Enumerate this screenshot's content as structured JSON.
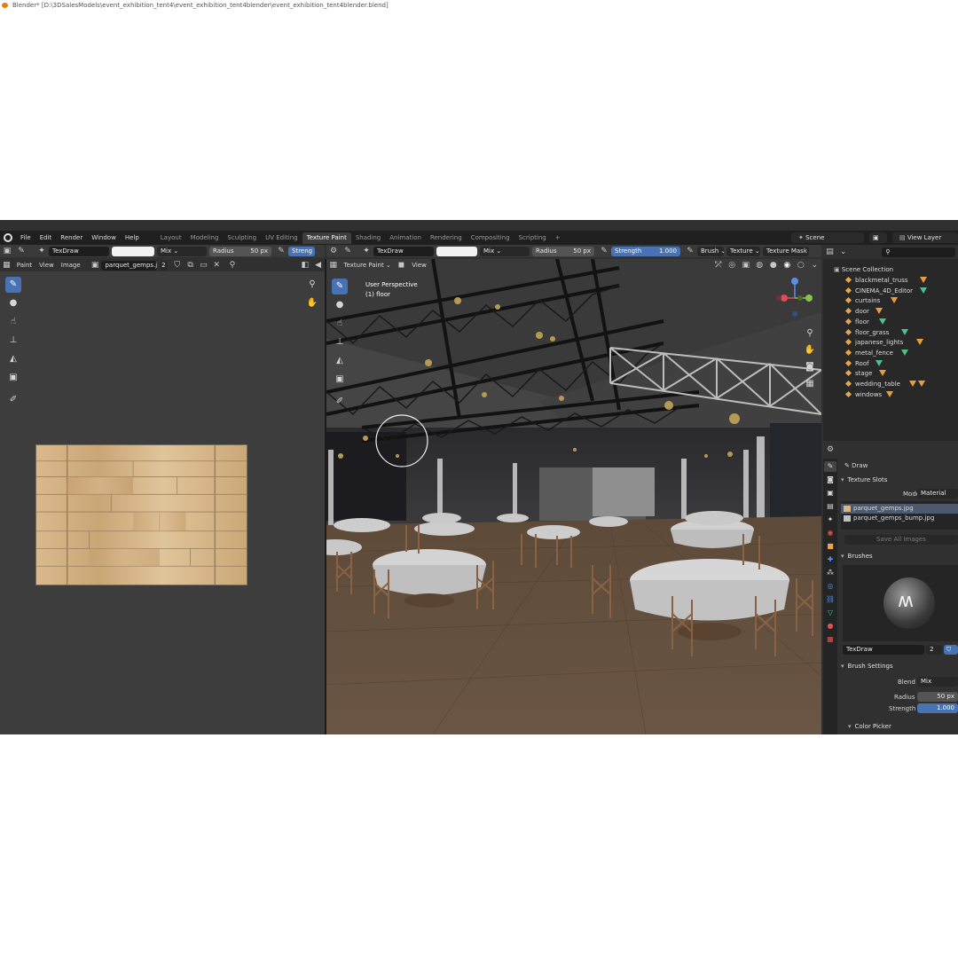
{
  "window": {
    "title": "Blender* [D:\\3DSalesModels\\event_exhibition_tent4\\event_exhibition_tent4blender\\event_exhibition_tent4blender.blend]"
  },
  "menu": [
    "File",
    "Edit",
    "Render",
    "Window",
    "Help"
  ],
  "workspaces": [
    "Layout",
    "Modeling",
    "Sculpting",
    "UV Editing",
    "Texture Paint",
    "Shading",
    "Animation",
    "Rendering",
    "Compositing",
    "Scripting"
  ],
  "active_workspace": "Texture Paint",
  "add_tab": "+",
  "scene": "Scene",
  "view_layer": "View Layer",
  "left_header": {
    "brush": "TexDraw",
    "blend": "Mix",
    "radius_label": "Radius",
    "radius_value": "50 px",
    "strength_label": "Streng"
  },
  "left_subheader": {
    "mode": "Paint",
    "view": "View",
    "image": "Image",
    "image_name": "parquet_gemps.jpg",
    "users": "2"
  },
  "viewport_header": {
    "brush": "TexDraw",
    "blend": "Mix",
    "radius_label": "Radius",
    "radius_value": "50 px",
    "strength_label": "Strength",
    "strength_value": "1.000",
    "brush_menu": "Brush",
    "texture_menu": "Texture",
    "mask_menu": "Texture Mask"
  },
  "viewport_subheader": {
    "mode": "Texture Paint",
    "view": "View"
  },
  "viewport_overlay": {
    "perspective": "User Perspective",
    "object": "(1) floor"
  },
  "outliner": {
    "root": "Scene Collection",
    "items": [
      "blackmetal_truss",
      "CINEMA_4D_Editor",
      "curtains",
      "door",
      "floor",
      "floor_grass",
      "japanese_lights",
      "metal_fence",
      "Roof",
      "stage",
      "wedding_table",
      "windows"
    ]
  },
  "properties": {
    "tool_name": "Draw",
    "texture_slots_label": "Texture Slots",
    "mode_label": "Mode",
    "mode_value": "Material",
    "slots": [
      "parquet_gemps.jpg",
      "parquet_gemps_bump.jpg"
    ],
    "save_all": "Save All Images",
    "brushes_label": "Brushes",
    "brush_name": "TexDraw",
    "brush_users": "2",
    "brush_settings_label": "Brush Settings",
    "blend_label": "Blend",
    "blend_value": "Mix",
    "radius_label": "Radius",
    "radius_value": "50 px",
    "strength_label": "Strength",
    "strength_value": "1.000",
    "color_picker_label": "Color Picker"
  },
  "colors": {
    "accent": "#4772b3",
    "bg": "#303030",
    "header": "#3a3a3a"
  }
}
